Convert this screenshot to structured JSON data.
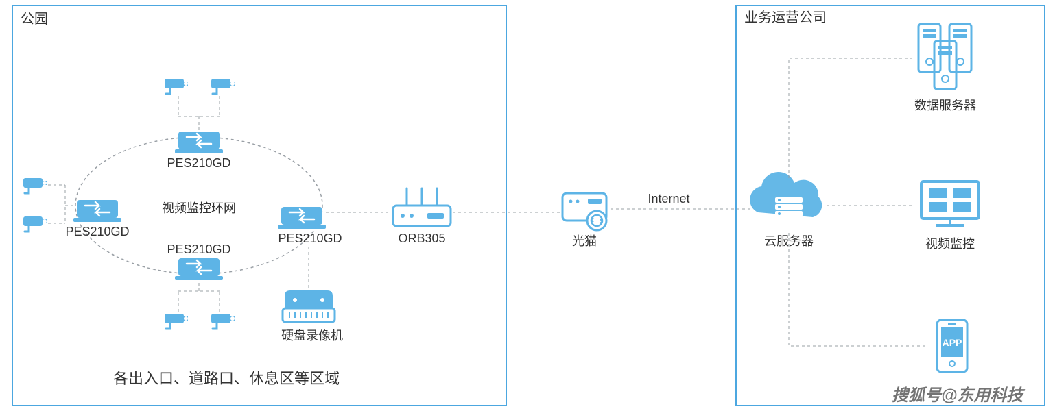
{
  "colors": {
    "box_border": "#4ca7e0",
    "icon": "#5db4e6",
    "line": "#9aa0a6",
    "text": "#333333"
  },
  "park": {
    "title": "公园",
    "ring_label": "视频监控环网",
    "switches": {
      "top": "PES210GD",
      "left": "PES210GD",
      "right": "PES210GD",
      "bottom": "PES210GD"
    },
    "dvr": "硬盘录像机",
    "caption": "各出入口、道路口、休息区等区域"
  },
  "router": "ORB305",
  "modem": "光猫",
  "internet": "Internet",
  "cloud": "云服务器",
  "company": {
    "title": "业务运营公司",
    "servers": "数据服务器",
    "monitor": "视频监控",
    "app": "APP"
  },
  "watermark": "搜狐号@东用科技"
}
